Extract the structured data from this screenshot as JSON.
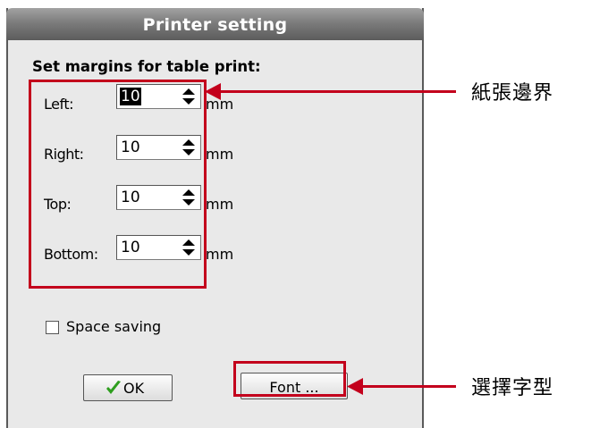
{
  "dialog": {
    "title": "Printer setting",
    "heading": "Set margins for table print:",
    "margins": [
      {
        "label": "Left:",
        "value": "10",
        "unit": "mm",
        "selected": true
      },
      {
        "label": "Right:",
        "value": "10",
        "unit": "mm",
        "selected": false
      },
      {
        "label": "Top:",
        "value": "10",
        "unit": "mm",
        "selected": false
      },
      {
        "label": "Bottom:",
        "value": "10",
        "unit": "mm",
        "selected": false
      }
    ],
    "space_saving_label": "Space saving",
    "space_saving_checked": false,
    "ok_label": "OK",
    "font_label": "Font ..."
  },
  "annotations": {
    "margins": "紙張邊界",
    "font": "選擇字型"
  },
  "colors": {
    "highlight": "#c3001c",
    "check_icon": "#2e9e1e",
    "titlebar": "#7c7c7c"
  }
}
